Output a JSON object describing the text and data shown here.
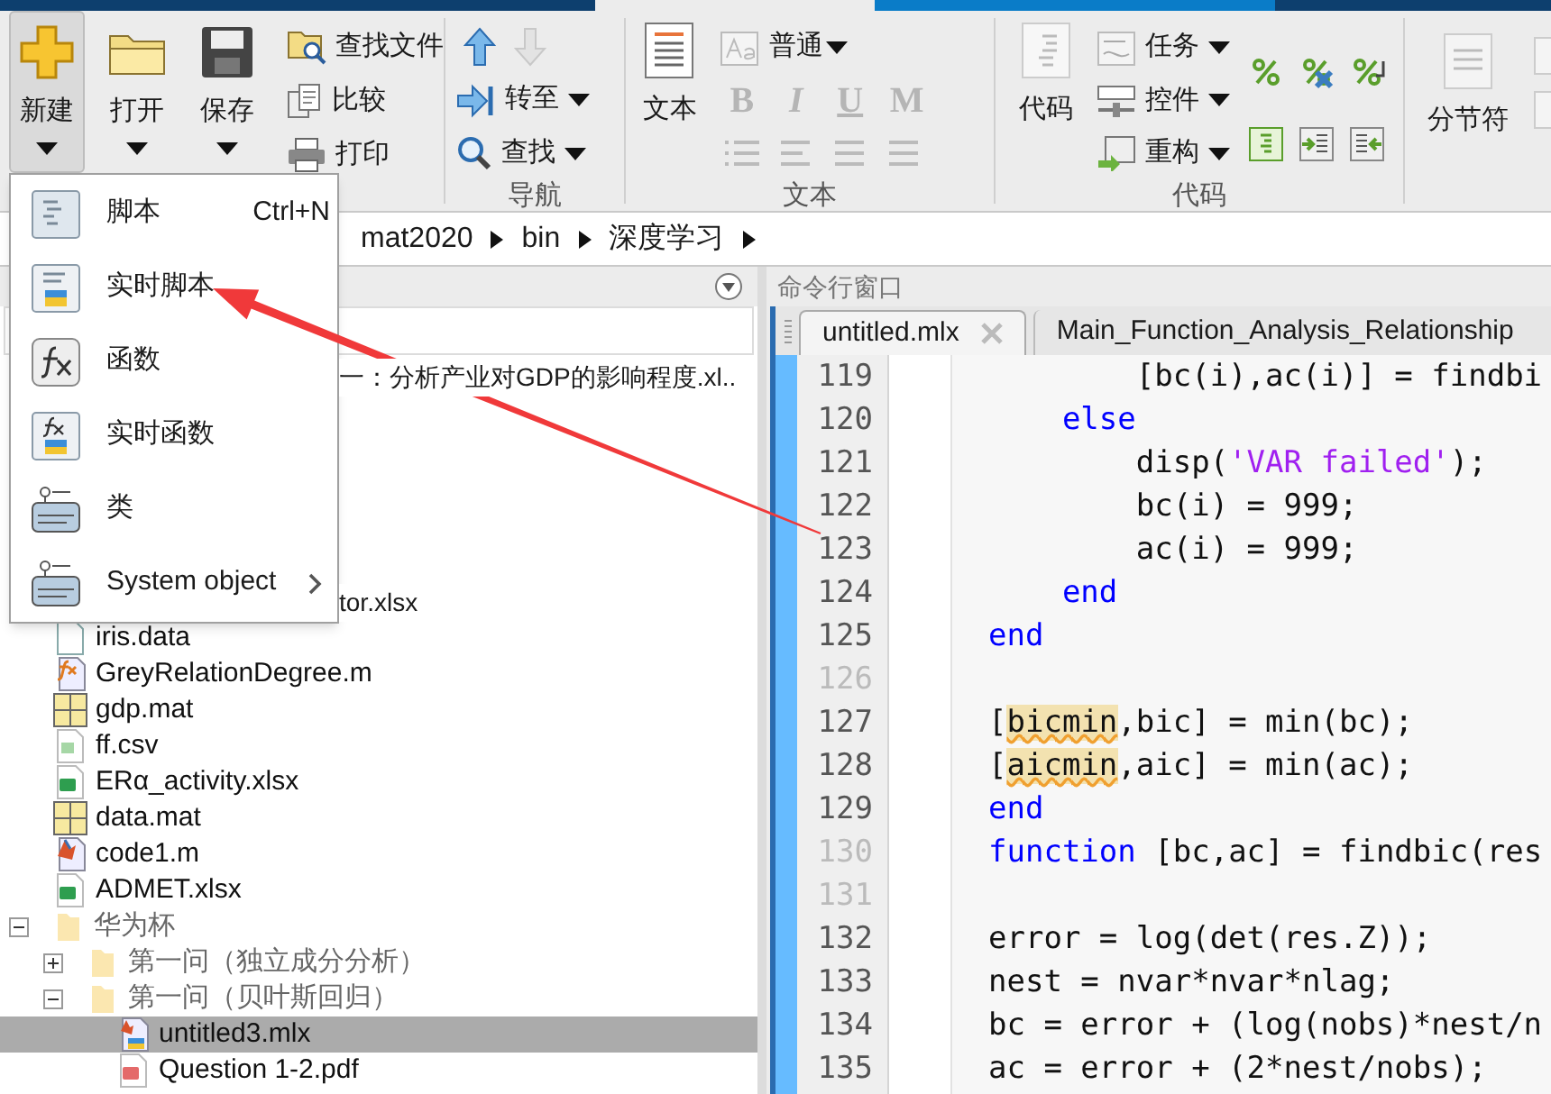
{
  "toolbar": {
    "file_group": {
      "large_buttons": [
        {
          "label": "新建",
          "pressed": true
        },
        {
          "label": "打开",
          "pressed": false
        },
        {
          "label": "保存",
          "pressed": false
        }
      ],
      "small_buttons": [
        {
          "label": "查找文件"
        },
        {
          "label": "比较"
        },
        {
          "label": "打印"
        }
      ]
    },
    "navigation_group": {
      "label": "导航",
      "arrows": [
        {
          "disabled": false
        },
        {
          "disabled": true
        }
      ],
      "buttons": [
        {
          "label": "转至"
        },
        {
          "label": "查找"
        }
      ]
    },
    "text_group": {
      "label": "文本",
      "big_button": "文本",
      "style_dropdown": "普通",
      "format_buttons": [
        {
          "label": "B",
          "disabled": true
        },
        {
          "label": "I",
          "disabled": true
        },
        {
          "label": "U",
          "disabled": true
        },
        {
          "label": "M",
          "disabled": true
        }
      ]
    },
    "code_group": {
      "label": "代码",
      "big_button": "代码",
      "dropdowns": [
        {
          "label": "任务"
        },
        {
          "label": "控件"
        },
        {
          "label": "重构"
        }
      ]
    },
    "section_group": {
      "big_button": "分节符"
    }
  },
  "address_bar": {
    "path": [
      "mat2020",
      "bin",
      "深度学习"
    ]
  },
  "new_menu": {
    "items": [
      {
        "label": "脚本",
        "shortcut": "Ctrl+N",
        "submenu": false
      },
      {
        "label": "实时脚本",
        "submenu": false
      },
      {
        "label": "函数",
        "submenu": false
      },
      {
        "label": "实时函数",
        "submenu": false
      },
      {
        "label": "类",
        "submenu": false
      },
      {
        "label": "System object",
        "submenu": true
      }
    ]
  },
  "file_browser": {
    "items": [
      {
        "kind": "clipped",
        "name": "一：分析产业对GDP的影响程度.xl..",
        "selected": false
      },
      {
        "kind": "clipped",
        "name": "tor.xlsx",
        "selected": false
      },
      {
        "kind": "text",
        "name": "iris.data",
        "selected": false
      },
      {
        "kind": "function",
        "name": "GreyRelationDegree.m",
        "selected": false
      },
      {
        "kind": "mat",
        "name": "gdp.mat",
        "selected": false
      },
      {
        "kind": "csv",
        "name": "ff.csv",
        "selected": false
      },
      {
        "kind": "excel",
        "name": "ERα_activity.xlsx",
        "selected": false
      },
      {
        "kind": "mat",
        "name": "data.mat",
        "selected": false
      },
      {
        "kind": "script",
        "name": "code1.m",
        "selected": false
      },
      {
        "kind": "excel",
        "name": "ADMET.xlsx",
        "selected": false
      },
      {
        "kind": "folder",
        "name": "华为杯",
        "expanded": true,
        "selected": false,
        "children": [
          {
            "kind": "folder",
            "name": "第一问（独立成分分析）",
            "expanded": false,
            "selected": false
          },
          {
            "kind": "folder",
            "name": "第一问（贝叶斯回归）",
            "expanded": true,
            "selected": false,
            "children": [
              {
                "kind": "live",
                "name": "untitled3.mlx",
                "selected": true
              },
              {
                "kind": "pdf",
                "name": "Question 1-2.pdf",
                "selected": false
              }
            ]
          }
        ]
      }
    ]
  },
  "command_window": {
    "title": "命令行窗口"
  },
  "editor": {
    "tabs": [
      {
        "label": "untitled.mlx",
        "selected": true,
        "closable": true
      },
      {
        "label": "Main_Function_Analysis_Relationship",
        "selected": false,
        "closable": false
      }
    ],
    "lines": [
      {
        "number": "119",
        "dimmed": false,
        "segments": [
          {
            "kind": "plain",
            "text": "        [bc(i),ac(i)] = findbi"
          }
        ]
      },
      {
        "number": "120",
        "dimmed": false,
        "segments": [
          {
            "kind": "keyword",
            "text": "    else"
          }
        ]
      },
      {
        "number": "121",
        "dimmed": false,
        "segments": [
          {
            "kind": "plain",
            "text": "        disp("
          },
          {
            "kind": "string",
            "text": "'VAR failed'"
          },
          {
            "kind": "plain",
            "text": ");"
          }
        ]
      },
      {
        "number": "122",
        "dimmed": false,
        "segments": [
          {
            "kind": "plain",
            "text": "        bc(i) = 999;"
          }
        ]
      },
      {
        "number": "123",
        "dimmed": false,
        "segments": [
          {
            "kind": "plain",
            "text": "        ac(i) = 999;"
          }
        ]
      },
      {
        "number": "124",
        "dimmed": false,
        "segments": [
          {
            "kind": "keyword",
            "text": "    end"
          }
        ]
      },
      {
        "number": "125",
        "dimmed": false,
        "segments": [
          {
            "kind": "keyword",
            "text": "end"
          }
        ]
      },
      {
        "number": "126",
        "dimmed": true
      },
      {
        "number": "127",
        "dimmed": false,
        "segments": [
          {
            "kind": "plain",
            "text": "["
          },
          {
            "kind": "warning",
            "text": "bicmin"
          },
          {
            "kind": "plain",
            "text": ",bic] = min(bc);"
          }
        ]
      },
      {
        "number": "128",
        "dimmed": false,
        "segments": [
          {
            "kind": "plain",
            "text": "["
          },
          {
            "kind": "warning",
            "text": "aicmin"
          },
          {
            "kind": "plain",
            "text": ",aic] = min(ac);"
          }
        ]
      },
      {
        "number": "129",
        "dimmed": false,
        "segments": [
          {
            "kind": "keyword",
            "text": "end"
          }
        ]
      },
      {
        "number": "130",
        "dimmed": true,
        "segments": [
          {
            "kind": "keyword",
            "text": "function"
          },
          {
            "kind": "plain",
            "text": " [bc,ac] = findbic(res"
          }
        ]
      },
      {
        "number": "131",
        "dimmed": true
      },
      {
        "number": "132",
        "dimmed": false,
        "segments": [
          {
            "kind": "plain",
            "text": "error = log(det(res.Z));"
          }
        ]
      },
      {
        "number": "133",
        "dimmed": false,
        "segments": [
          {
            "kind": "plain",
            "text": "nest = nvar*nvar*nlag;"
          }
        ]
      },
      {
        "number": "134",
        "dimmed": false,
        "segments": [
          {
            "kind": "plain",
            "text": "bc = error + (log(nobs)*nest/n"
          }
        ]
      },
      {
        "number": "135",
        "dimmed": false,
        "segments": [
          {
            "kind": "plain",
            "text": "ac = error + (2*nest/nobs);"
          }
        ]
      }
    ]
  }
}
